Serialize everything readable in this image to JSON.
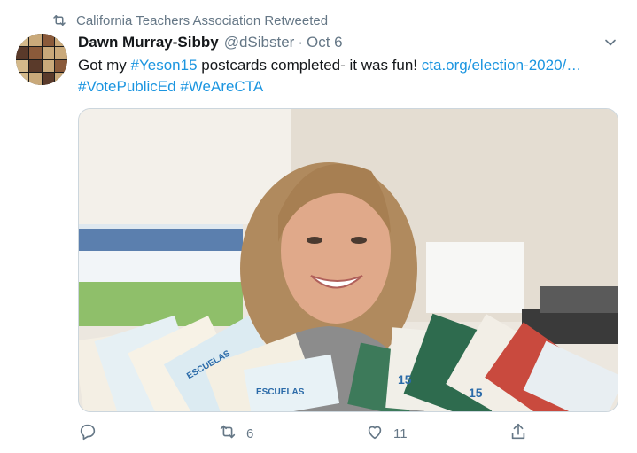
{
  "retweet_context": {
    "text": "California Teachers Association Retweeted",
    "icon": "retweet-icon"
  },
  "tweet": {
    "author_name": "Dawn Murray-Sibby",
    "handle": "@dSibster",
    "separator": "·",
    "date": "Oct 6",
    "text_part1": "Got my ",
    "hashtag1": "#Yeson15",
    "text_part2": " postcards completed- it was fun! ",
    "link": "cta.org/election-2020/…",
    "hashtag2": "#VotePublicEd",
    "hashtag3": "#WeAreCTA",
    "media_alt": "Photo of a smiling woman holding fanned-out Yes on 15 postcards"
  },
  "actions": {
    "reply": {
      "icon": "reply-icon",
      "count": ""
    },
    "retweet": {
      "icon": "retweet-icon",
      "count": "6"
    },
    "like": {
      "icon": "heart-icon",
      "count": "11"
    },
    "share": {
      "icon": "share-icon",
      "count": ""
    }
  },
  "colors": {
    "link": "#1b95e0",
    "muted": "#657786",
    "text": "#14171a",
    "border": "#ccd6dd"
  }
}
